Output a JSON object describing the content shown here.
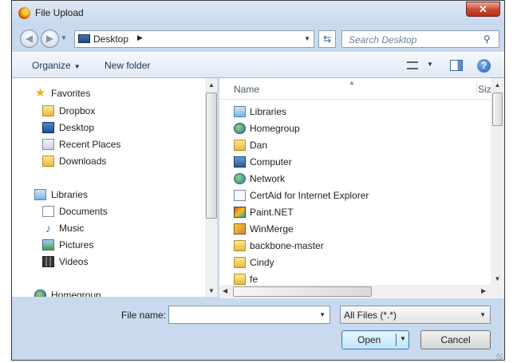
{
  "window": {
    "title": "File Upload",
    "close_label": "✕"
  },
  "address": {
    "location": "Desktop",
    "search_placeholder": "Search Desktop"
  },
  "toolbar": {
    "organize_label": "Organize",
    "new_folder_label": "New folder"
  },
  "nav_pane": {
    "groups": [
      {
        "label": "Favorites",
        "icon": "star-icon",
        "items": [
          {
            "label": "Dropbox",
            "icon": "folder-icon"
          },
          {
            "label": "Desktop",
            "icon": "desktop-icon"
          },
          {
            "label": "Recent Places",
            "icon": "recent-places-icon"
          },
          {
            "label": "Downloads",
            "icon": "folder-icon"
          }
        ]
      },
      {
        "label": "Libraries",
        "icon": "libraries-icon",
        "items": [
          {
            "label": "Documents",
            "icon": "document-icon"
          },
          {
            "label": "Music",
            "icon": "music-icon"
          },
          {
            "label": "Pictures",
            "icon": "pictures-icon"
          },
          {
            "label": "Videos",
            "icon": "videos-icon"
          }
        ]
      },
      {
        "label": "Homegroup",
        "icon": "homegroup-icon",
        "items": []
      }
    ]
  },
  "file_pane": {
    "columns": [
      "Name",
      "Siz"
    ],
    "items": [
      {
        "label": "Libraries",
        "icon": "libraries-icon"
      },
      {
        "label": "Homegroup",
        "icon": "homegroup-icon"
      },
      {
        "label": "Dan",
        "icon": "folder-icon"
      },
      {
        "label": "Computer",
        "icon": "computer-icon"
      },
      {
        "label": "Network",
        "icon": "network-icon"
      },
      {
        "label": "CertAid for Internet Explorer",
        "icon": "shortcut-icon"
      },
      {
        "label": "Paint.NET",
        "icon": "paint-icon"
      },
      {
        "label": "WinMerge",
        "icon": "winmerge-icon"
      },
      {
        "label": "backbone-master",
        "icon": "folder-icon"
      },
      {
        "label": "Cindy",
        "icon": "folder-icon"
      },
      {
        "label": "fe",
        "icon": "folder-icon"
      }
    ]
  },
  "bottom": {
    "file_name_label": "File name:",
    "file_name_value": "",
    "file_type_filter": "All Files (*.*)",
    "open_label": "Open",
    "cancel_label": "Cancel"
  }
}
